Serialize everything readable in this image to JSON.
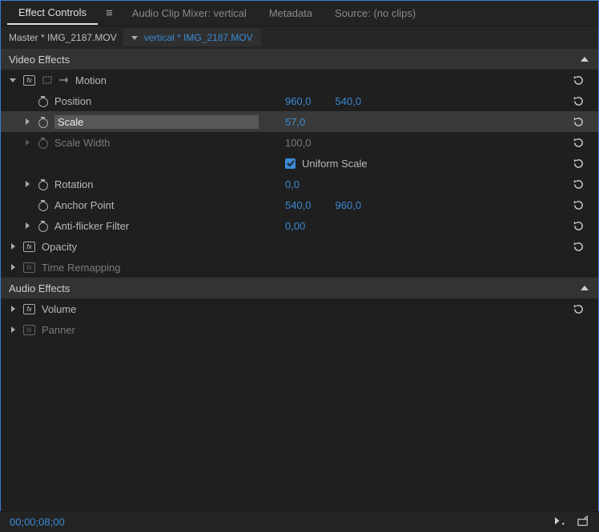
{
  "tabs": {
    "effect_controls": "Effect Controls",
    "audio_mixer": "Audio Clip Mixer: vertical",
    "metadata": "Metadata",
    "source": "Source: (no clips)"
  },
  "source_bar": {
    "master": "Master * IMG_2187.MOV",
    "clip": "vertical * IMG_2187.MOV"
  },
  "sections": {
    "video": "Video Effects",
    "audio": "Audio Effects"
  },
  "motion": {
    "label": "Motion",
    "position": {
      "label": "Position",
      "x": "960,0",
      "y": "540,0"
    },
    "scale": {
      "label": "Scale",
      "val": "57,0"
    },
    "scale_width": {
      "label": "Scale Width",
      "val": "100,0"
    },
    "uniform": "Uniform Scale",
    "rotation": {
      "label": "Rotation",
      "val": "0,0"
    },
    "anchor": {
      "label": "Anchor Point",
      "x": "540,0",
      "y": "960,0"
    },
    "anti_flicker": {
      "label": "Anti-flicker Filter",
      "val": "0,00"
    }
  },
  "opacity": {
    "label": "Opacity"
  },
  "time_remap": {
    "label": "Time Remapping"
  },
  "volume": {
    "label": "Volume"
  },
  "panner": {
    "label": "Panner"
  },
  "timecode": "00;00;08;00"
}
